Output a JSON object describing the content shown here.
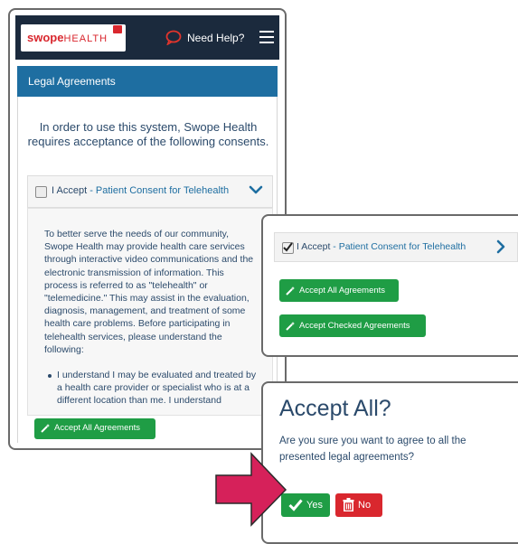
{
  "header": {
    "logo_bold": "swope",
    "logo_rest": "HEALTH",
    "help_label": "Need Help?"
  },
  "section_title": "Legal Agreements",
  "intro": "In order to use this system, Swope Health requires acceptance of the following consents.",
  "consent_item": {
    "accept_word": "I Accept",
    "name": " - Patient Consent for Telehealth",
    "checked_in_phone": false,
    "checked_in_overlay": true
  },
  "consent_text": "To better serve the needs of our community, Swope Health may provide health care services through interactive video communications and the electronic transmission of information. This process is referred to as \"telehealth\" or \"telemedicine.\" This may assist in the evaluation, diagnosis, management, and treatment of some health care problems. Before participating in telehealth services, please understand the following:",
  "consent_bullet": "I understand I may be evaluated and treated by a health care provider or specialist who is at a different location than me. I understand",
  "buttons": {
    "accept_all": "Accept All Agreements",
    "accept_checked": "Accept Checked Agreements"
  },
  "dialog": {
    "title": "Accept All?",
    "body": "Are you sure you want to agree to all the presented legal agreements?",
    "yes": "Yes",
    "no": "No"
  },
  "colors": {
    "navbar": "#1b2a3d",
    "section_bar": "#1e6ea1",
    "success": "#1f9d45",
    "danger": "#d9272e",
    "arrow": "#d6215a",
    "text": "#2b4a6b"
  }
}
